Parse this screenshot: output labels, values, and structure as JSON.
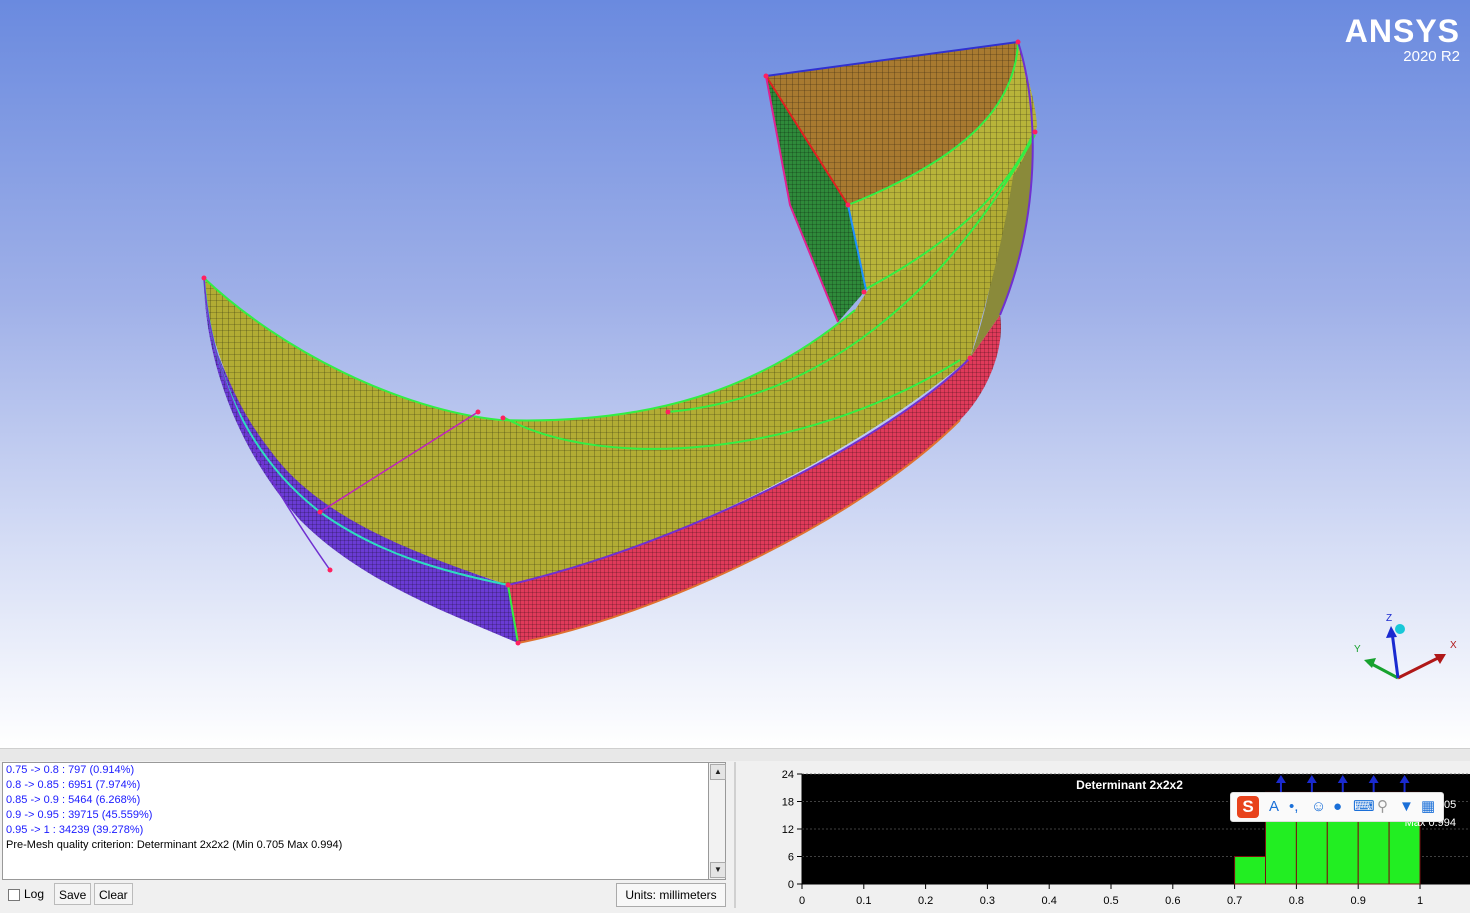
{
  "logo": {
    "brand": "ANSYS",
    "version": "2020 R2"
  },
  "axis_triad": {
    "x": "X",
    "y": "Y",
    "z": "Z"
  },
  "console": {
    "lines": [
      "0.75 -> 0.8 : 797 (0.914%)",
      "0.8 -> 0.85 : 6951 (7.974%)",
      "0.85 -> 0.9 : 5464 (6.268%)",
      "0.9 -> 0.95 : 39715 (45.559%)",
      "0.95 -> 1 : 34239 (39.278%)",
      "Pre-Mesh quality criterion: Determinant 2x2x2 (Min 0.705 Max 0.994)"
    ],
    "line_colors": [
      "#1a1aff",
      "#1a1aff",
      "#1a1aff",
      "#1a1aff",
      "#1a1aff",
      "#000000"
    ]
  },
  "toolbar": {
    "log_label": "Log",
    "save_label": "Save",
    "clear_label": "Clear",
    "units_label": "Units: millimeters"
  },
  "chart_data": {
    "type": "bar",
    "title": "Determinant 2x2x2",
    "annotations": [
      "05",
      "Max 0.994"
    ],
    "bins": [
      [
        0.7,
        0.75
      ],
      [
        0.75,
        0.8
      ],
      [
        0.8,
        0.85
      ],
      [
        0.85,
        0.9
      ],
      [
        0.9,
        0.95
      ],
      [
        0.95,
        1.0
      ]
    ],
    "values": [
      6,
      20,
      20,
      20,
      20,
      20
    ],
    "clipped": [
      false,
      true,
      true,
      true,
      true,
      true
    ],
    "xticks": [
      "0",
      "0.1",
      "0.2",
      "0.3",
      "0.4",
      "0.5",
      "0.6",
      "0.7",
      "0.8",
      "0.9",
      "1"
    ],
    "yticks": [
      "0",
      "6",
      "12",
      "18",
      "24"
    ],
    "xlim": [
      0,
      1
    ],
    "ylim": [
      0,
      24
    ],
    "bar_color": "#22ee22",
    "background": "#000000",
    "grid": true
  },
  "ime_toolbar": {
    "logo": "S"
  }
}
